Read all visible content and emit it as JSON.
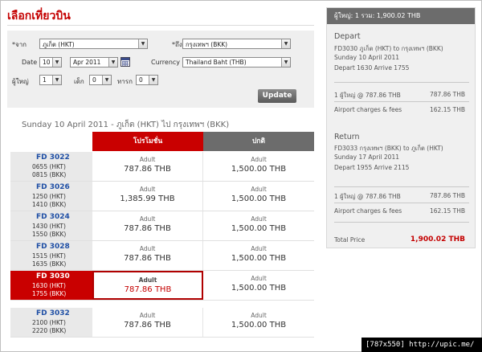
{
  "page": {
    "title": "เลือกเที่ยวบิน"
  },
  "search": {
    "from_label": "*จาก",
    "from_value": "ภูเก็ต (HKT)",
    "to_label": "*ถึง",
    "to_value": "กรุงเทพฯ (BKK)",
    "date_label": "Date",
    "day_value": "10",
    "month_value": "Apr 2011",
    "currency_label": "Currency",
    "currency_value": "Thailand Baht (THB)",
    "adult_label": "ผู้ใหญ่",
    "adult_value": "1",
    "child_label": "เด็ก",
    "child_value": "0",
    "infant_label": "ทารก",
    "infant_value": "0",
    "update_label": "Update",
    "arrow_glyph": "▼",
    "calendar_icon": "calendar-icon"
  },
  "results": {
    "date_heading": "Sunday 10 April 2011 - ภูเก็ต (HKT)  ไป  กรุงเทพฯ (BKK)",
    "col_promo": "โปรโมชั่น",
    "col_normal": "ปกติ",
    "rows": [
      {
        "flight": "FD 3022",
        "dep": "0655  (HKT)",
        "arr": "0815  (BKK)",
        "promo_pax": "Adult",
        "promo": "787.86 THB",
        "normal_pax": "Adult",
        "normal": "1,500.00 THB"
      },
      {
        "flight": "FD 3026",
        "dep": "1250  (HKT)",
        "arr": "1410  (BKK)",
        "promo_pax": "Adult",
        "promo": "1,385.99 THB",
        "normal_pax": "Adult",
        "normal": "1,500.00 THB"
      },
      {
        "flight": "FD 3024",
        "dep": "1430  (HKT)",
        "arr": "1550  (BKK)",
        "promo_pax": "Adult",
        "promo": "787.86 THB",
        "normal_pax": "Adult",
        "normal": "1,500.00 THB"
      },
      {
        "flight": "FD 3028",
        "dep": "1515  (HKT)",
        "arr": "1635  (BKK)",
        "promo_pax": "Adult",
        "promo": "787.86 THB",
        "normal_pax": "Adult",
        "normal": "1,500.00 THB"
      },
      {
        "flight": "FD 3030",
        "dep": "1630  (HKT)",
        "arr": "1755  (BKK)",
        "promo_pax": "Adult",
        "promo": "787.86 THB",
        "normal_pax": "Adult",
        "normal": "1,500.00 THB",
        "selected": true
      },
      {
        "flight": "FD 3032",
        "dep": "2100  (HKT)",
        "arr": "2220  (BKK)",
        "promo_pax": "Adult",
        "promo": "787.86 THB",
        "normal_pax": "Adult",
        "normal": "1,500.00 THB"
      }
    ]
  },
  "summary": {
    "header": "ผู้ใหญ่: 1   รวม: 1,900.02 THB",
    "depart_title": "Depart",
    "depart_flight": "FD3030 ภูเก็ต (HKT) to กรุงเทพฯ (BKK)",
    "depart_date": "Sunday 10 April 2011",
    "depart_times": "Depart 1630 Arrive 1755",
    "depart_fare_label": "1 ผู้ใหญ่ @ 787.86 THB",
    "depart_fare_amt": "787.86 THB",
    "depart_fees_label": "Airport charges & fees",
    "depart_fees_amt": "162.15 THB",
    "return_title": "Return",
    "return_flight": "FD3033 กรุงเทพฯ (BKK) to ภูเก็ต (HKT)",
    "return_date": "Sunday 17 April 2011",
    "return_times": "Depart 1955 Arrive 2115",
    "return_fare_label": "1 ผู้ใหญ่ @ 787.86 THB",
    "return_fare_amt": "787.86 THB",
    "return_fees_label": "Airport charges & fees",
    "return_fees_amt": "162.15 THB",
    "total_label": "Total Price",
    "total_amt": "1,900.02 THB"
  },
  "watermark": "[787x550] http://upic.me/",
  "colors": {
    "accent": "#c90000",
    "header_gray": "#6c6c6c",
    "link_blue": "#1f4fa5"
  }
}
